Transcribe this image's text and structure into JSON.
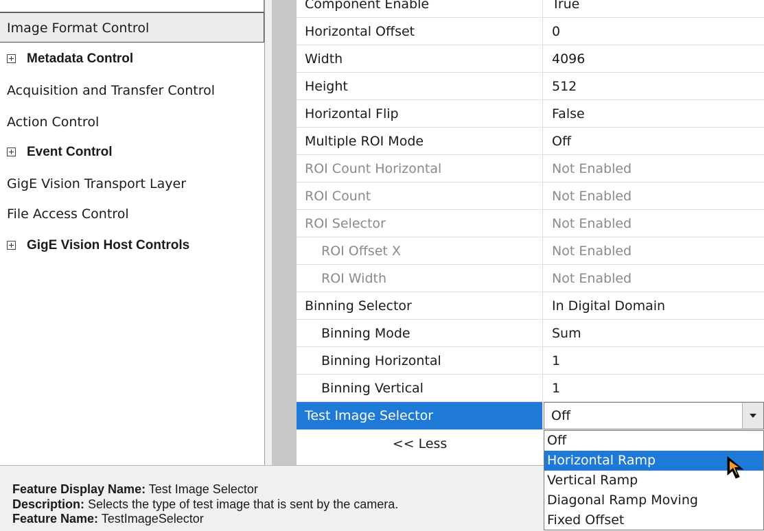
{
  "tree": {
    "items": [
      {
        "label": "Image Format Control",
        "selected": true,
        "expandable": false
      },
      {
        "label": "Metadata Control",
        "expandable": true
      },
      {
        "label": "Acquisition and Transfer Control",
        "expandable": false
      },
      {
        "label": "Action Control",
        "expandable": false
      },
      {
        "label": "Event Control",
        "expandable": true
      },
      {
        "label": "GigE Vision Transport Layer",
        "expandable": false
      },
      {
        "label": "File Access Control",
        "expandable": false
      },
      {
        "label": "GigE Vision Host Controls",
        "expandable": true
      }
    ]
  },
  "grid": {
    "partial_row": {
      "name": "Component Enable",
      "value": "True"
    },
    "rows": [
      {
        "name": "Horizontal Offset",
        "value": "0"
      },
      {
        "name": "Width",
        "value": "4096"
      },
      {
        "name": "Height",
        "value": "512"
      },
      {
        "name": "Horizontal Flip",
        "value": "False"
      },
      {
        "name": "Multiple ROI Mode",
        "value": "Off"
      },
      {
        "name": "ROI Count Horizontal",
        "value": "Not Enabled"
      },
      {
        "name": "ROI Count",
        "value": "Not Enabled"
      },
      {
        "name": "ROI Selector",
        "value": "Not Enabled"
      },
      {
        "name": "ROI Offset X",
        "value": "Not Enabled"
      },
      {
        "name": "ROI Width",
        "value": "Not Enabled"
      },
      {
        "name": "Binning Selector",
        "value": "In Digital Domain"
      },
      {
        "name": "Binning Mode",
        "value": "Sum"
      },
      {
        "name": "Binning Horizontal",
        "value": "1"
      },
      {
        "name": "Binning Vertical",
        "value": "1"
      },
      {
        "name": "Test Image Selector",
        "value": "Off"
      }
    ],
    "less_label": "<< Less"
  },
  "dropdown": {
    "selected_value": "Off",
    "options": [
      "Off",
      "Horizontal Ramp",
      "Vertical Ramp",
      "Diagonal Ramp Moving",
      "Fixed Offset"
    ],
    "highlighted": "Horizontal Ramp"
  },
  "description": {
    "display_name_label": "Feature Display Name:",
    "display_name_value": "Test Image Selector",
    "description_label": "Description:",
    "description_value": "Selects the type of test image that is sent by the camera.",
    "feature_name_label": "Feature Name:",
    "feature_name_value": "TestImageSelector"
  },
  "colors": {
    "selection": "#1e7ad6",
    "disabled_text": "#8a8a8a"
  },
  "icons": {
    "expander": "plus-box-icon",
    "combo": "chevron-down-icon",
    "cursor": "mouse-pointer-icon"
  }
}
